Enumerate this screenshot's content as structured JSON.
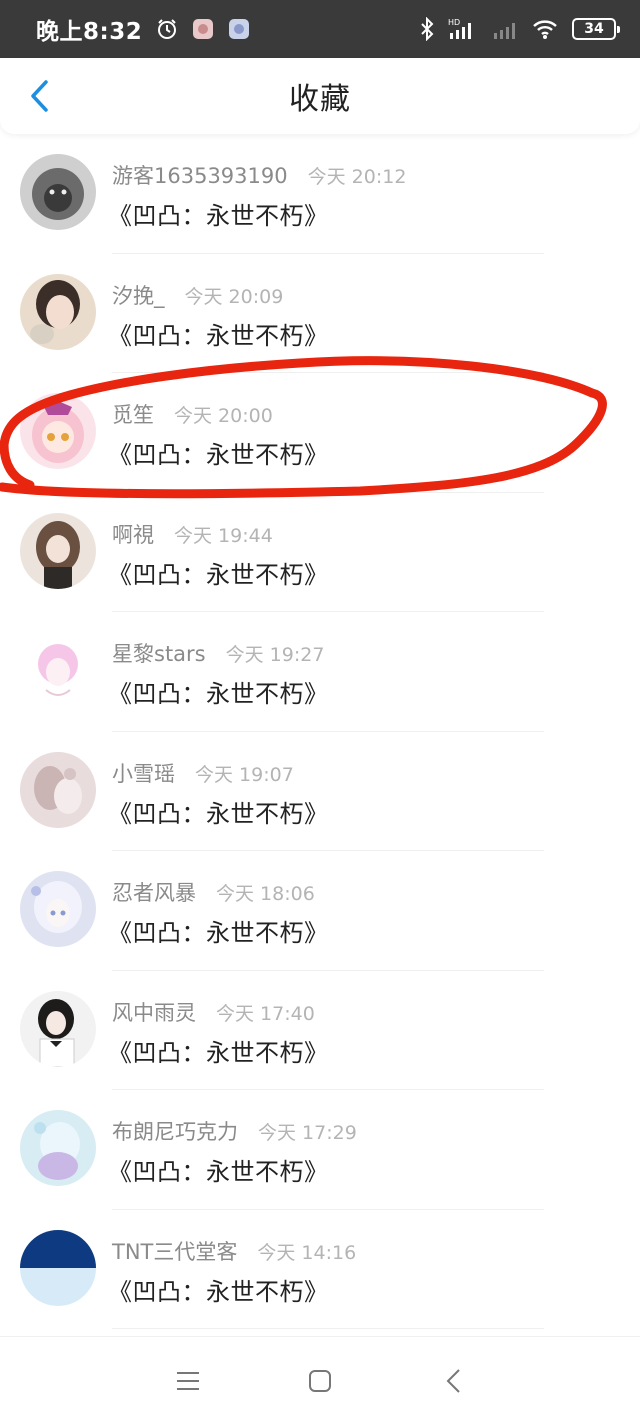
{
  "status_bar": {
    "time": "晚上8:32",
    "battery": "34",
    "icons": [
      "alarm-icon",
      "app-icon",
      "app-icon",
      "bluetooth-icon",
      "hd-signal-icon",
      "signal-icon",
      "wifi-icon"
    ]
  },
  "header": {
    "title": "收藏",
    "back_icon": "chevron-left-icon"
  },
  "items": [
    {
      "username": "游客1635393190",
      "time": "今天 20:12",
      "title": "《凹凸：永世不朽》"
    },
    {
      "username": "汐挽_",
      "time": "今天 20:09",
      "title": "《凹凸：永世不朽》"
    },
    {
      "username": "觅笙",
      "time": "今天 20:00",
      "title": "《凹凸：永世不朽》"
    },
    {
      "username": "啊視",
      "time": "今天 19:44",
      "title": "《凹凸：永世不朽》"
    },
    {
      "username": "星黎stars",
      "time": "今天 19:27",
      "title": "《凹凸：永世不朽》"
    },
    {
      "username": "小雪瑶",
      "time": "今天 19:07",
      "title": "《凹凸：永世不朽》"
    },
    {
      "username": "忍者风暴",
      "time": "今天 18:06",
      "title": "《凹凸：永世不朽》"
    },
    {
      "username": "风中雨灵",
      "time": "今天 17:40",
      "title": "《凹凸：永世不朽》"
    },
    {
      "username": "布朗尼巧克力",
      "time": "今天 17:29",
      "title": "《凹凸：永世不朽》"
    },
    {
      "username": "TNT三代堂客",
      "time": "今天 14:16",
      "title": "《凹凸：永世不朽》"
    }
  ],
  "nav": {
    "icons": [
      "menu-icon",
      "home-square-icon",
      "back-triangle-icon"
    ]
  },
  "colors": {
    "accent": "#1e8fe0",
    "annotation": "#e8260f",
    "status_bar": "#3a3a3a"
  }
}
